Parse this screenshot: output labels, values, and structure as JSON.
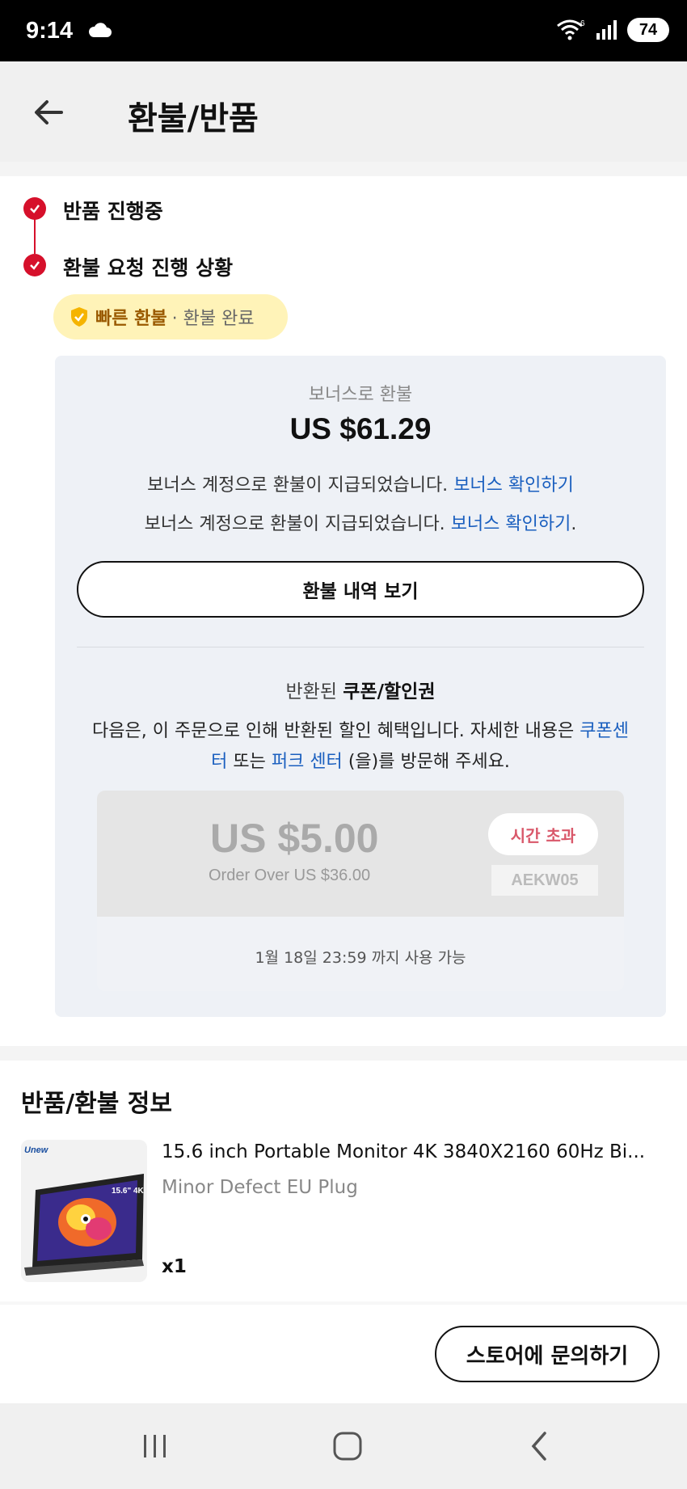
{
  "status_bar": {
    "time": "9:14",
    "battery": "74",
    "wifi_label": "6"
  },
  "header": {
    "title": "환불/반품"
  },
  "progress": {
    "steps": [
      {
        "label": "반품 진행중"
      },
      {
        "label": "환불 요청 진행 상황"
      }
    ],
    "badge": {
      "strong": "빠른 환불",
      "sub": "· 환불 완료"
    }
  },
  "refund": {
    "subtitle": "보너스로 환불",
    "amount": "US $61.29",
    "message1": "보너스 계정으로 환불이 지급되었습니다.",
    "link1": "보너스 확인하기",
    "message2": "보너스 계정으로 환불이 지급되었습니다.",
    "link2": "보너스 확인하기",
    "link2_suffix": ".",
    "history_button": "환불 내역 보기"
  },
  "coupons": {
    "title_prefix": "반환된",
    "title_strong": "쿠폰/할인권",
    "desc_part1": "다음은, 이 주문으로 인해 반환된 할인 혜택입니다. 자세한 내용은",
    "desc_link1": "쿠폰센터",
    "desc_part2": "또는",
    "desc_link2": "퍼크 센터",
    "desc_part3": "(을)를 방문해 주세요.",
    "item": {
      "amount": "US $5.00",
      "condition": "Order Over US $36.00",
      "status": "시간 초과",
      "code": "AEKW05",
      "validity": "1월 18일 23:59 까지 사용 가능"
    }
  },
  "return_info": {
    "title": "반품/환불 정보",
    "product": {
      "name": "15.6 inch Portable Monitor 4K 3840X2160 60Hz Bi...",
      "variant": "Minor Defect EU Plug",
      "quantity": "x1",
      "brand_mark": "Unew",
      "image_text": "15.6\" 4K"
    }
  },
  "actions": {
    "contact_store": "스토어에 문의하기"
  },
  "colors": {
    "accent": "#d6102b",
    "link": "#1a5fbf",
    "badge_bg": "#fff3b8",
    "card_bg": "#eef1f6"
  }
}
